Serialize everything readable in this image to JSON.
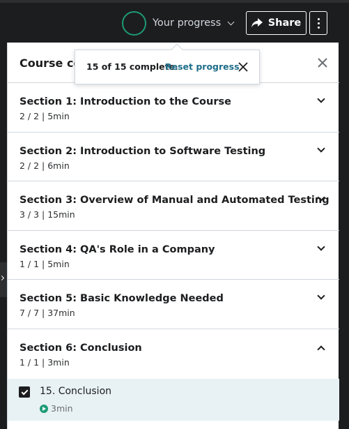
{
  "topbar": {
    "progress_label": "Your progress",
    "share_label": "Share"
  },
  "panel": {
    "title": "Course content"
  },
  "popover": {
    "status": "15 of 15 complete.",
    "reset_link": "Reset progress"
  },
  "sections": [
    {
      "title": "Section 1: Introduction to the Course",
      "meta": "2 / 2 | 5min",
      "expanded": false
    },
    {
      "title": "Section 2: Introduction to Software Testing",
      "meta": "2 / 2 | 6min",
      "expanded": false
    },
    {
      "title": "Section 3: Overview of Manual and Automated Testing",
      "meta": "3 / 3 | 15min",
      "expanded": false
    },
    {
      "title": "Section 4: QA's Role in a Company",
      "meta": "1 / 1 | 5min",
      "expanded": false
    },
    {
      "title": "Section 5: Basic Knowledge Needed",
      "meta": "7 / 7 | 37min",
      "expanded": false
    },
    {
      "title": "Section 6: Conclusion",
      "meta": "1 / 1 | 3min",
      "expanded": true
    }
  ],
  "lecture": {
    "title": "15. Conclusion",
    "duration": "3min",
    "completed": true
  },
  "colors": {
    "accent_green": "#1e9b77",
    "link_blue": "#1e6e8a",
    "active_row": "#e8f1f4",
    "topbar_bg": "#1c1d1f"
  },
  "icons": [
    "progress-ring-icon",
    "chevron-down-icon",
    "share-icon",
    "more-vertical-icon",
    "close-icon",
    "chevron-up-icon",
    "checkbox-checked-icon",
    "play-circle-icon"
  ]
}
